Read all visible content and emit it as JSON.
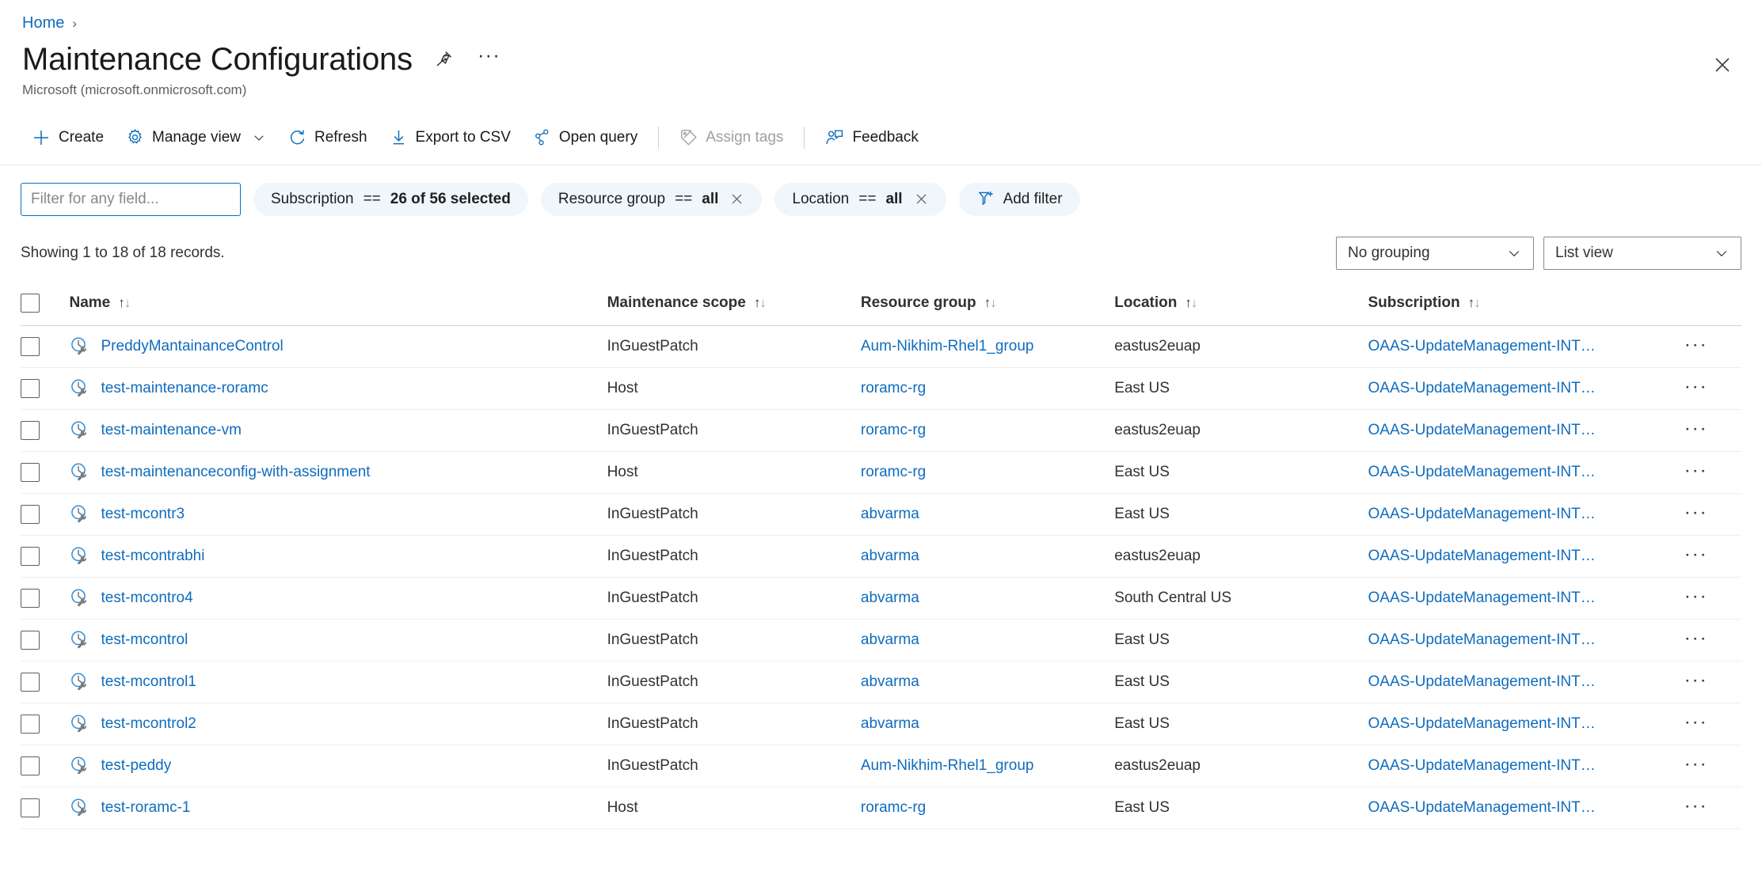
{
  "breadcrumb": {
    "home": "Home",
    "separator": "›"
  },
  "header": {
    "title": "Maintenance Configurations",
    "subtitle": "Microsoft (microsoft.onmicrosoft.com)",
    "pin_icon": "pin-icon",
    "more_label": "···",
    "close_icon": "close-icon"
  },
  "toolbar": {
    "create": "Create",
    "manage_view": "Manage view",
    "refresh": "Refresh",
    "export_csv": "Export to CSV",
    "open_query": "Open query",
    "assign_tags": "Assign tags",
    "assign_tags_disabled": true,
    "feedback": "Feedback"
  },
  "filters": {
    "search_placeholder": "Filter for any field...",
    "search_value": "",
    "pills": [
      {
        "field": "Subscription",
        "op": "==",
        "value": "26 of 56 selected",
        "removable": false
      },
      {
        "field": "Resource group",
        "op": "==",
        "value": "all",
        "removable": true
      },
      {
        "field": "Location",
        "op": "==",
        "value": "all",
        "removable": true
      }
    ],
    "add_filter": "Add filter"
  },
  "summary": {
    "records_text": "Showing 1 to 18 of 18 records.",
    "grouping": "No grouping",
    "view": "List view"
  },
  "table": {
    "columns": [
      {
        "label": "Name",
        "sorted": "asc"
      },
      {
        "label": "Maintenance scope",
        "sorted": "none"
      },
      {
        "label": "Resource group",
        "sorted": "none"
      },
      {
        "label": "Location",
        "sorted": "none"
      },
      {
        "label": "Subscription",
        "sorted": "none"
      }
    ],
    "row_menu_label": "···",
    "rows": [
      {
        "name": "PreddyMantainanceControl",
        "scope": "InGuestPatch",
        "resource_group": "Aum-Nikhim-Rhel1_group",
        "location": "eastus2euap",
        "subscription": "OAAS-UpdateManagement-INT…"
      },
      {
        "name": "test-maintenance-roramc",
        "scope": "Host",
        "resource_group": "roramc-rg",
        "location": "East US",
        "subscription": "OAAS-UpdateManagement-INT…"
      },
      {
        "name": "test-maintenance-vm",
        "scope": "InGuestPatch",
        "resource_group": "roramc-rg",
        "location": "eastus2euap",
        "subscription": "OAAS-UpdateManagement-INT…"
      },
      {
        "name": "test-maintenanceconfig-with-assignment",
        "scope": "Host",
        "resource_group": "roramc-rg",
        "location": "East US",
        "subscription": "OAAS-UpdateManagement-INT…"
      },
      {
        "name": "test-mcontr3",
        "scope": "InGuestPatch",
        "resource_group": "abvarma",
        "location": "East US",
        "subscription": "OAAS-UpdateManagement-INT…"
      },
      {
        "name": "test-mcontrabhi",
        "scope": "InGuestPatch",
        "resource_group": "abvarma",
        "location": "eastus2euap",
        "subscription": "OAAS-UpdateManagement-INT…"
      },
      {
        "name": "test-mcontro4",
        "scope": "InGuestPatch",
        "resource_group": "abvarma",
        "location": "South Central US",
        "subscription": "OAAS-UpdateManagement-INT…"
      },
      {
        "name": "test-mcontrol",
        "scope": "InGuestPatch",
        "resource_group": "abvarma",
        "location": "East US",
        "subscription": "OAAS-UpdateManagement-INT…"
      },
      {
        "name": "test-mcontrol1",
        "scope": "InGuestPatch",
        "resource_group": "abvarma",
        "location": "East US",
        "subscription": "OAAS-UpdateManagement-INT…"
      },
      {
        "name": "test-mcontrol2",
        "scope": "InGuestPatch",
        "resource_group": "abvarma",
        "location": "East US",
        "subscription": "OAAS-UpdateManagement-INT…"
      },
      {
        "name": "test-peddy",
        "scope": "InGuestPatch",
        "resource_group": "Aum-Nikhim-Rhel1_group",
        "location": "eastus2euap",
        "subscription": "OAAS-UpdateManagement-INT…"
      },
      {
        "name": "test-roramc-1",
        "scope": "Host",
        "resource_group": "roramc-rg",
        "location": "East US",
        "subscription": "OAAS-UpdateManagement-INT…"
      }
    ]
  },
  "colors": {
    "link": "#0f6cbd",
    "pill_bg": "#eff6fc",
    "text": "#323130",
    "disabled": "#a19f9d",
    "row_divider": "#f0efee"
  }
}
